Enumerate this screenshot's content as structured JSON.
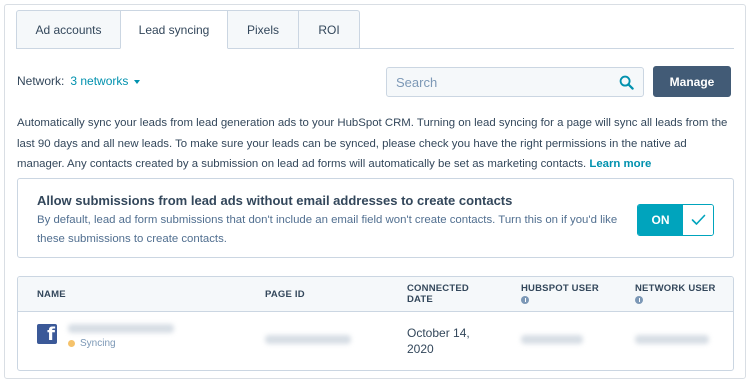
{
  "tabs": [
    {
      "label": "Ad accounts",
      "active": false
    },
    {
      "label": "Lead syncing",
      "active": true
    },
    {
      "label": "Pixels",
      "active": false
    },
    {
      "label": "ROI",
      "active": false
    }
  ],
  "network": {
    "label": "Network:",
    "value": "3 networks"
  },
  "search": {
    "placeholder": "Search",
    "value": ""
  },
  "manage_button": "Manage",
  "description": {
    "text": "Automatically sync your leads from lead generation ads to your HubSpot CRM. Turning on lead syncing for a page will sync all leads from the last 90 days and all new leads. To make sure your leads can be synced, please check you have the right permissions in the native ad manager. Any contacts created by a submission on lead ad forms will automatically be set as marketing contacts. ",
    "learn_more": "Learn more"
  },
  "allow_setting": {
    "title": "Allow submissions from lead ads without email addresses to create contacts",
    "body": "By default, lead ad form submissions that don't include an email field won't create contacts. Turn this on if you'd like these submissions to create contacts.",
    "toggle_label": "ON",
    "enabled": true
  },
  "table": {
    "columns": [
      "NAME",
      "PAGE ID",
      "CONNECTED DATE",
      "HUBSPOT USER",
      "NETWORK USER"
    ],
    "rows": [
      {
        "network_icon": "facebook-icon",
        "status": "Syncing",
        "status_color": "#f5c26b",
        "connected_date": "October 14, 2020"
      }
    ]
  },
  "colors": {
    "accent": "#0091ae",
    "toggle": "#00a4bd",
    "manage_button": "#425b76",
    "text": "#33475b"
  }
}
